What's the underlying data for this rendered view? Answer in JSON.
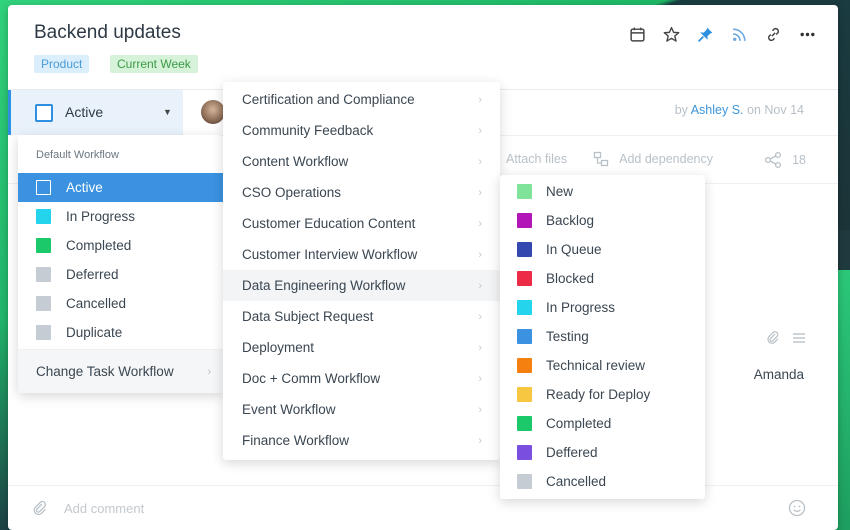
{
  "task": {
    "title": "Backend updates",
    "tags": [
      "Product",
      "Current Week"
    ],
    "status": "Active",
    "author_prefix": "by",
    "author": "Ashley S.",
    "date": "on Nov 14"
  },
  "toolbar": {
    "icons": [
      "calendar-icon",
      "star-icon",
      "pin-icon",
      "rss-icon",
      "link-icon",
      "more-icon"
    ],
    "pin_color": "#2f8fe0"
  },
  "actions": {
    "attach": "Attach files",
    "dependency": "Add dependency",
    "share_count": "18"
  },
  "assignee": "Amanda",
  "comment": {
    "placeholder": "Add comment"
  },
  "status_menu": {
    "heading": "Default Workflow",
    "items": [
      {
        "label": "Active",
        "color": "#3a92e0"
      },
      {
        "label": "In Progress",
        "color": "#24d4ec"
      },
      {
        "label": "Completed",
        "color": "#1bc96a"
      },
      {
        "label": "Deferred",
        "color": "#c6ccd4"
      },
      {
        "label": "Cancelled",
        "color": "#c6ccd4"
      },
      {
        "label": "Duplicate",
        "color": "#c6ccd4"
      }
    ],
    "change_workflow": "Change Task Workflow"
  },
  "workflows": [
    "Certification and Compliance",
    "Community Feedback",
    "Content Workflow",
    "CSO Operations",
    "Customer Education Content",
    "Customer Interview Workflow",
    "Data Engineering Workflow",
    "Data Subject Request",
    "Deployment",
    "Doc + Comm Workflow",
    "Event Workflow",
    "Finance Workflow"
  ],
  "workflow_statuses": [
    {
      "label": "New",
      "color": "#7fe39a"
    },
    {
      "label": "Backlog",
      "color": "#b316b8"
    },
    {
      "label": "In Queue",
      "color": "#3448b0"
    },
    {
      "label": "Blocked",
      "color": "#ec2b46"
    },
    {
      "label": "In Progress",
      "color": "#24d4ec"
    },
    {
      "label": "Testing",
      "color": "#3a92e0"
    },
    {
      "label": "Technical review",
      "color": "#f57f0f"
    },
    {
      "label": "Ready for Deploy",
      "color": "#f7c742"
    },
    {
      "label": "Completed",
      "color": "#1bc96a"
    },
    {
      "label": "Deffered",
      "color": "#7a4fe0"
    },
    {
      "label": "Cancelled",
      "color": "#c6ccd4"
    }
  ]
}
